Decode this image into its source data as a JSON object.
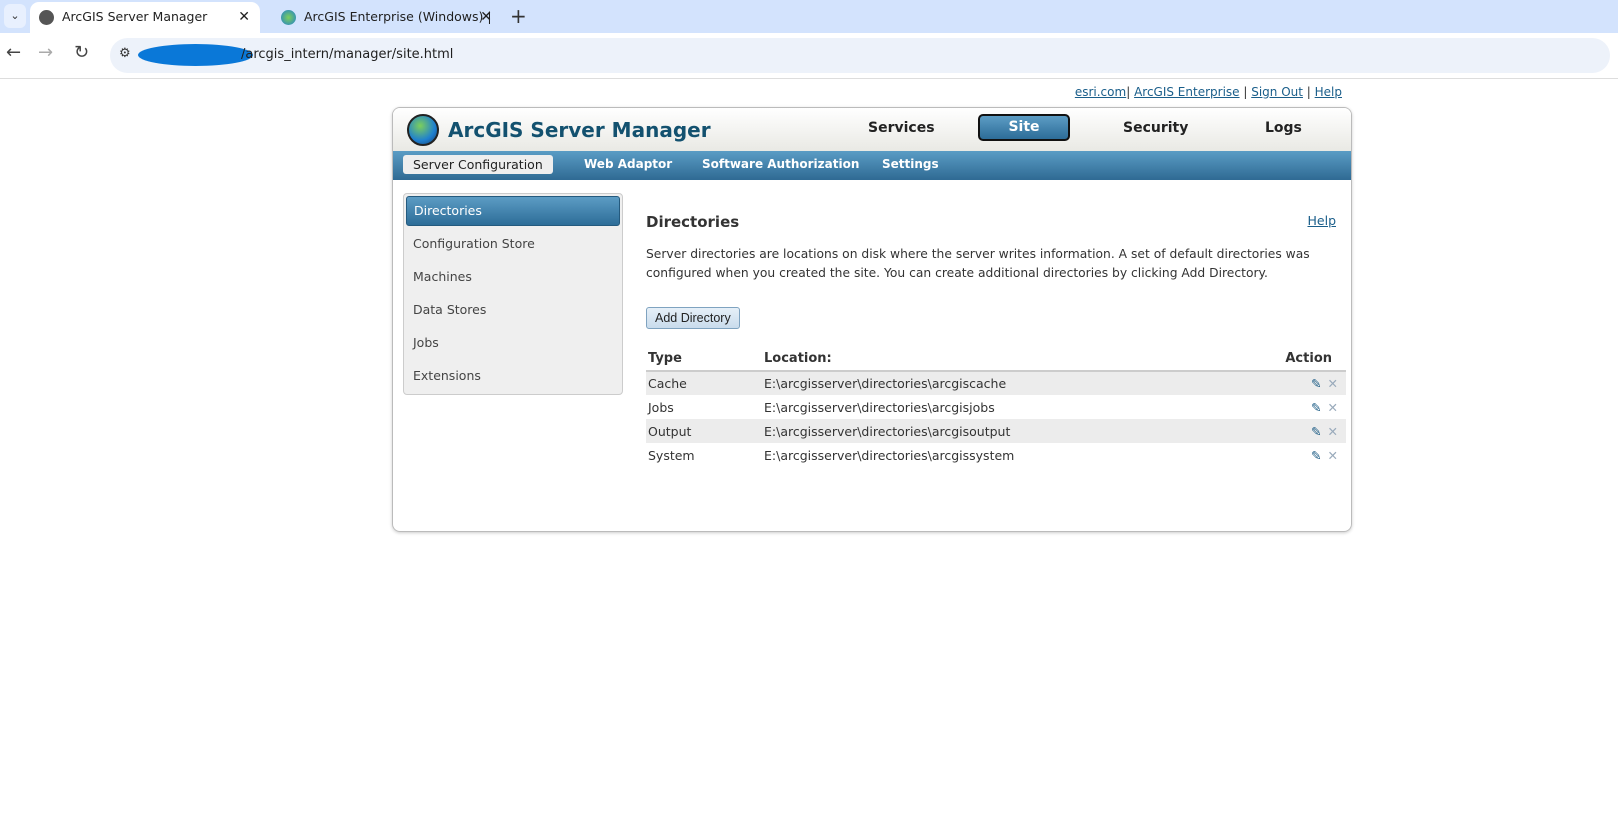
{
  "browser": {
    "tabs": [
      {
        "title": "ArcGIS Server Manager",
        "active": true
      },
      {
        "title": "ArcGIS Enterprise (Windows) | M",
        "active": false
      }
    ],
    "url": "/arcgis_intern/manager/site.html"
  },
  "top_links": [
    "esri.com",
    "ArcGIS Enterprise",
    "Sign Out",
    "Help"
  ],
  "header": {
    "brand": "ArcGIS Server Manager",
    "tabs": [
      "Services",
      "Site",
      "Security",
      "Logs"
    ],
    "active": "Site"
  },
  "subnav": [
    "Server Configuration",
    "Web Adaptor",
    "Software Authorization",
    "Settings"
  ],
  "sidebar": [
    "Directories",
    "Configuration Store",
    "Machines",
    "Data Stores",
    "Jobs",
    "Extensions"
  ],
  "main": {
    "title": "Directories",
    "help": "Help",
    "description": "Server directories are locations on disk where the server writes information. A set of default directories was configured when you created the site. You can create additional directories by clicking Add Directory.",
    "add_button": "Add Directory",
    "columns": [
      "Type",
      "Location:",
      "Action"
    ],
    "rows": [
      {
        "type": "Cache",
        "location": "E:\\arcgisserver\\directories\\arcgiscache"
      },
      {
        "type": "Jobs",
        "location": "E:\\arcgisserver\\directories\\arcgisjobs"
      },
      {
        "type": "Output",
        "location": "E:\\arcgisserver\\directories\\arcgisoutput"
      },
      {
        "type": "System",
        "location": "E:\\arcgisserver\\directories\\arcgissystem"
      }
    ]
  },
  "colors": {
    "accent": "#2f6a93",
    "brand": "#13516f"
  }
}
